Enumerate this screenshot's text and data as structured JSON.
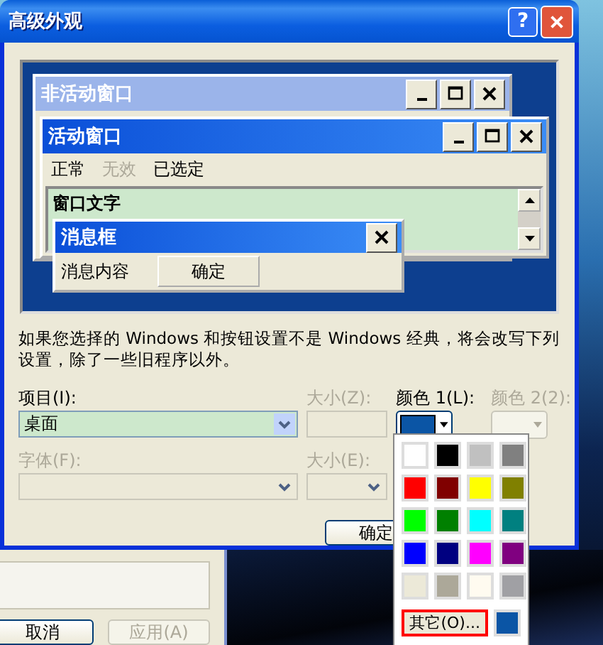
{
  "dialog": {
    "title": "高级外观",
    "help": "?"
  },
  "preview": {
    "inactive_window": {
      "title": "非活动窗口"
    },
    "active_window": {
      "title": "活动窗口",
      "menu": [
        {
          "label": "正常",
          "disabled": false
        },
        {
          "label": "无效",
          "disabled": true
        },
        {
          "label": "已选定",
          "disabled": false
        }
      ],
      "text": "窗口文字"
    },
    "message_box": {
      "title": "消息框",
      "text": "消息内容",
      "button": "确定"
    }
  },
  "note": "如果您选择的 Windows 和按钮设置不是 Windows 经典，将会改写下列设置，除了一些旧程序以外。",
  "fields": [
    {
      "kind": "combo",
      "label": "项目(I):",
      "value": "桌面",
      "disabled": false
    },
    {
      "kind": "spinner",
      "label": "大小(Z):",
      "disabled": true
    },
    {
      "kind": "color",
      "label": "颜色 1(L):",
      "color": "#0b55a5",
      "disabled": false
    },
    {
      "kind": "color",
      "label": "颜色 2(2):",
      "disabled": true
    },
    {
      "kind": "combo",
      "label": "字体(F):",
      "disabled": true
    },
    {
      "kind": "combo",
      "label": "大小(E):",
      "disabled": true
    }
  ],
  "ok_button": "确定",
  "palette": {
    "swatches": [
      {
        "color": "#ffffff"
      },
      {
        "color": "#000000"
      },
      {
        "color": "#c0c0c0"
      },
      {
        "color": "#808080"
      },
      {
        "color": "#ff0000"
      },
      {
        "color": "#800000"
      },
      {
        "color": "#ffff00"
      },
      {
        "color": "#808000"
      },
      {
        "color": "#00ff00"
      },
      {
        "color": "#008000"
      },
      {
        "color": "#00ffff"
      },
      {
        "color": "#008080"
      },
      {
        "color": "#0000ff"
      },
      {
        "color": "#000080"
      },
      {
        "color": "#ff00ff"
      },
      {
        "color": "#800080"
      },
      {
        "color": "#ece9d8"
      },
      {
        "color": "#aca899"
      },
      {
        "color": "#fffbf0"
      },
      {
        "color": "#a0a0a4"
      }
    ],
    "other_button": "其它(O)...",
    "other_highlighted": true,
    "custom_swatch": {
      "color": "#0b55a5"
    }
  },
  "background_window": {
    "buttons": [
      {
        "label": "取消",
        "disabled": false
      },
      {
        "label": "应用(A)",
        "disabled": true
      }
    ]
  }
}
